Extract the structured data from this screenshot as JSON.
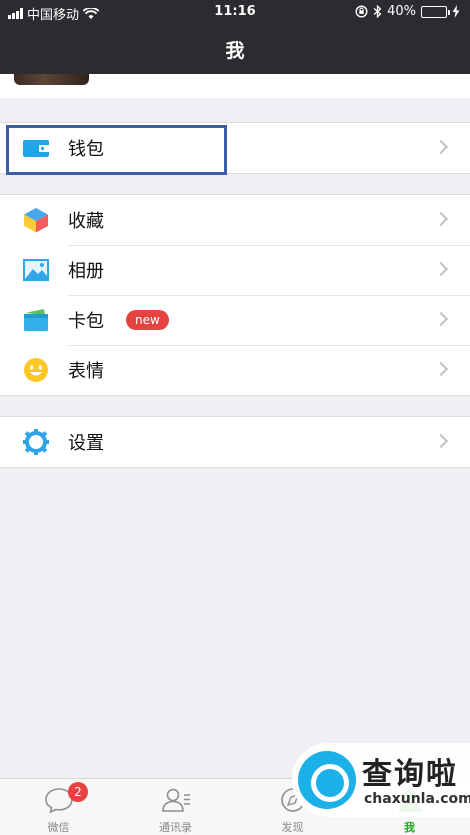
{
  "status_bar": {
    "carrier": "中国移动",
    "time": "11:16",
    "battery_percent": "40%",
    "battery_level": 0.4
  },
  "header": {
    "title": "我"
  },
  "wallet_group": {
    "items": [
      {
        "label": "钱包",
        "icon": "wallet-icon"
      }
    ]
  },
  "main_group": {
    "items": [
      {
        "label": "收藏",
        "icon": "favorites-cube-icon"
      },
      {
        "label": "相册",
        "icon": "album-icon"
      },
      {
        "label": "卡包",
        "icon": "card-pack-icon",
        "badge": "new"
      },
      {
        "label": "表情",
        "icon": "sticker-smiley-icon"
      }
    ]
  },
  "settings_group": {
    "items": [
      {
        "label": "设置",
        "icon": "settings-gear-icon"
      }
    ]
  },
  "tabbar": {
    "tabs": [
      {
        "label": "微信",
        "icon": "chat-bubble-icon",
        "badge": "2"
      },
      {
        "label": "通讯录",
        "icon": "contacts-icon"
      },
      {
        "label": "发现",
        "icon": "compass-icon"
      },
      {
        "label": "我",
        "icon": "me-icon",
        "active": true
      }
    ]
  },
  "watermark": {
    "title": "查询啦",
    "url": "chaxunla.com"
  },
  "colors": {
    "header_bg": "#2b2b30",
    "page_bg": "#efeff4",
    "highlight_border": "#3a5fa8",
    "badge_red": "#e64340",
    "active_green": "#1aad19"
  }
}
